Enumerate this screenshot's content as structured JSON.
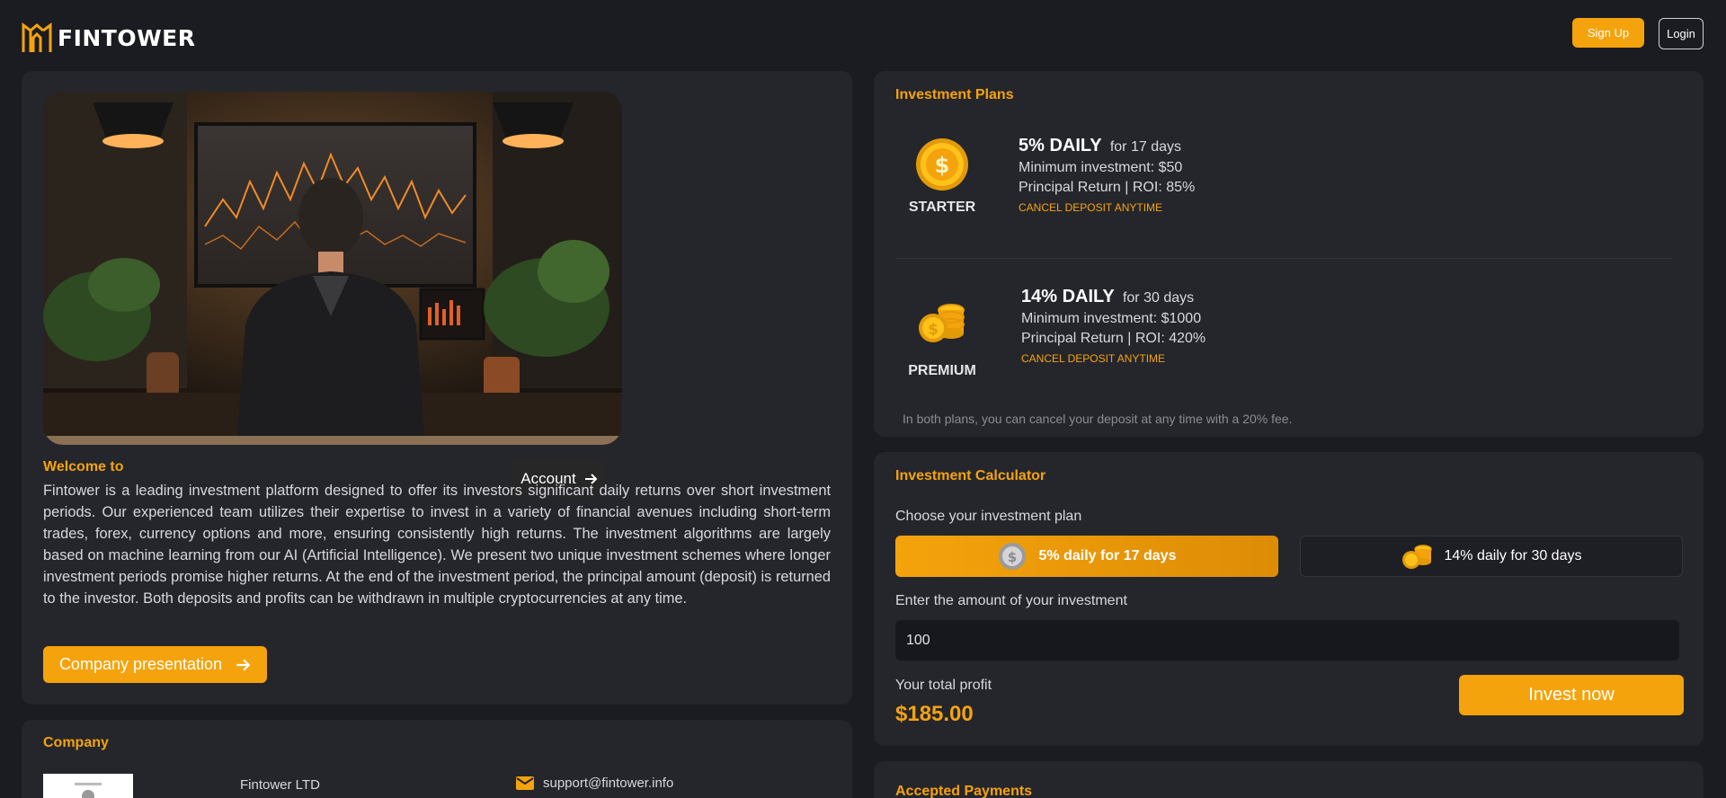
{
  "header": {
    "brand": "FINTOWER",
    "signup_label": "Sign Up",
    "login_label": "Login"
  },
  "hero": {
    "account_label": "Account"
  },
  "welcome": {
    "title": "Welcome to",
    "text": "Fintower is a leading investment platform designed to offer its investors significant daily returns over short investment periods. Our experienced team utilizes their expertise to invest in a variety of financial avenues including short-term trades, forex, currency options and more, ensuring consistently high returns. The investment algorithms are largely based on machine learning from our AI (Artificial Intelligence). We present two unique investment schemes where longer investment periods promise higher returns. At the end of the investment period, the principal amount (deposit) is returned to the investor. Both deposits and profits can be withdrawn in multiple cryptocurrencies at any time.",
    "presentation_label": "Company presentation"
  },
  "company": {
    "title": "Company",
    "name": "Fintower LTD",
    "email": "support@fintower.info"
  },
  "plans": {
    "title": "Investment Plans",
    "items": [
      {
        "name": "STARTER",
        "rate": "5% DAILY",
        "duration": "for 17 days",
        "minimum": "Minimum investment: $50",
        "roi": "Principal Return | ROI: 85%",
        "cancel": "CANCEL DEPOSIT ANYTIME",
        "icon": "coin-icon"
      },
      {
        "name": "PREMIUM",
        "rate": "14% DAILY",
        "duration": "for 30 days",
        "minimum": "Minimum investment: $1000",
        "roi": "Principal Return | ROI: 420%",
        "cancel": "CANCEL DEPOSIT ANYTIME",
        "icon": "coin-stack-icon"
      }
    ],
    "note": "In both plans, you can cancel your deposit at any time with a 20% fee."
  },
  "calculator": {
    "title": "Investment Calculator",
    "choose_label": "Choose your investment plan",
    "options": [
      "5% daily for 17 days",
      "14% daily for 30 days"
    ],
    "selected_option": "5% daily for 17 days",
    "amount_label": "Enter the amount of your investment",
    "amount_value": "100",
    "profit_label": "Your total profit",
    "profit_value": "$185.00",
    "invest_label": "Invest now"
  },
  "payments": {
    "title": "Accepted Payments"
  },
  "colors": {
    "accent": "#f5a30c",
    "background": "#1b1c22",
    "panel": "#25262c"
  }
}
